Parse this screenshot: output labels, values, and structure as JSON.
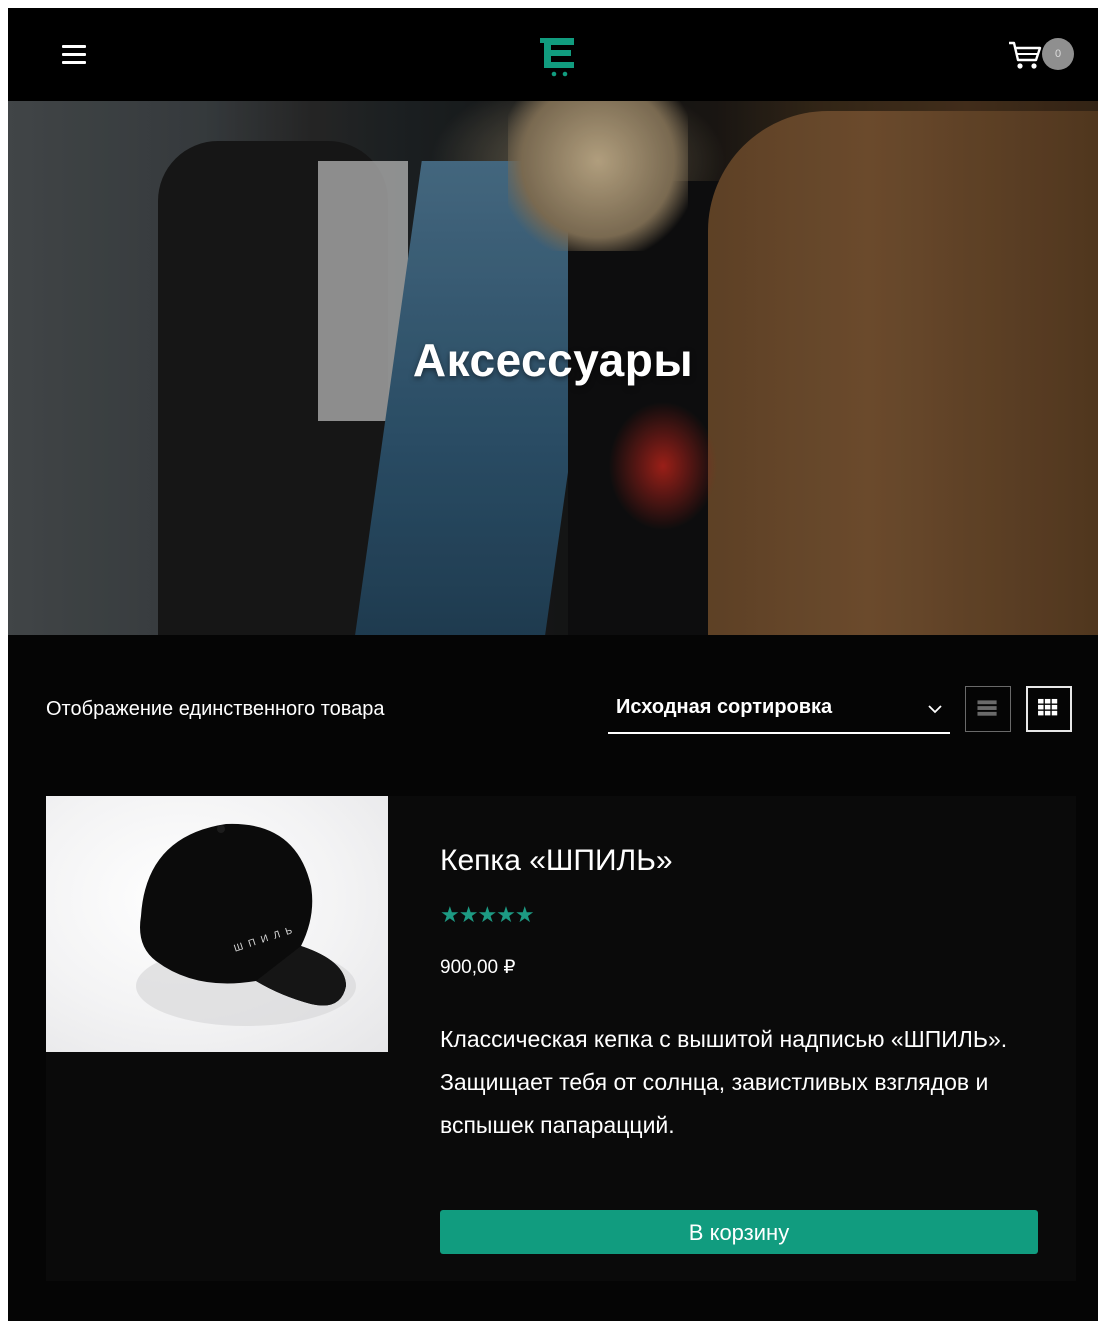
{
  "header": {
    "menu_icon": "hamburger-icon",
    "logo_icon": "cart-e-logo-icon",
    "cart_icon": "shopping-cart-icon",
    "cart_count": "0",
    "accent": "#119c7f"
  },
  "hero": {
    "title": "Аксессуары"
  },
  "toolbar": {
    "result_count": "Отображение единственного товара",
    "sort_selected": "Исходная сортировка",
    "view_list_icon": "list-view-icon",
    "view_grid_icon": "grid-view-icon"
  },
  "product": {
    "title": "Кепка «ШПИЛЬ»",
    "rating_stars": "★★★★★",
    "rating_value": 5,
    "price": "900,00 ₽",
    "description_line1": "Классическая кепка с вышитой надписью «ШПИЛЬ».",
    "description_line2": "Защищает тебя от солнца, завистливых взглядов и вспышек папарацций.",
    "button_label": "В корзину",
    "image_text": "ШПИЛЬ"
  }
}
